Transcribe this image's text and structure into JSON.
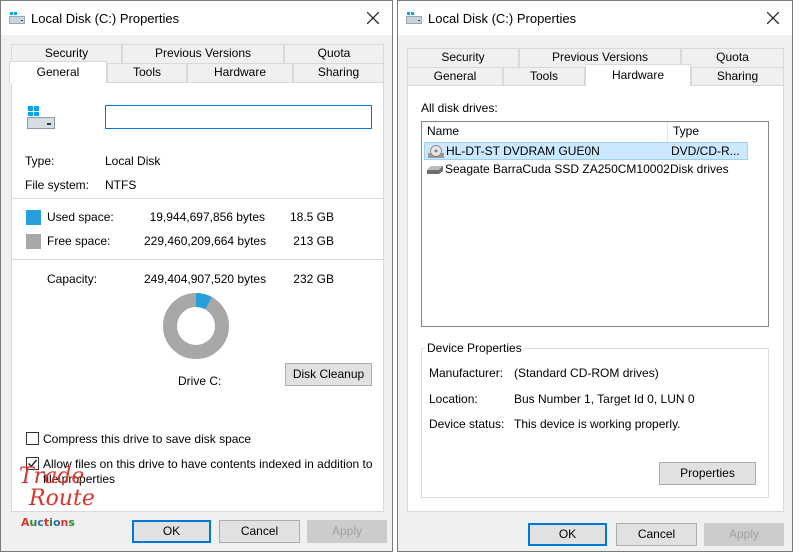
{
  "colors": {
    "used": "#26a0da",
    "free": "#a7a7a7",
    "selected_row": "#cce8ff"
  },
  "general_window": {
    "title": "Local Disk (C:) Properties",
    "tabs_top": [
      "Security",
      "Previous Versions",
      "Quota"
    ],
    "tabs_bottom": [
      "General",
      "Tools",
      "Hardware",
      "Sharing"
    ],
    "active_tab": "General",
    "name_value": "",
    "type_label": "Type:",
    "type_value": "Local Disk",
    "fs_label": "File system:",
    "fs_value": "NTFS",
    "used_label": "Used space:",
    "used_bytes": "19,944,697,856 bytes",
    "used_size": "18.5 GB",
    "free_label": "Free space:",
    "free_bytes": "229,460,209,664 bytes",
    "free_size": "213 GB",
    "capacity_label": "Capacity:",
    "capacity_bytes": "249,404,907,520 bytes",
    "capacity_size": "232 GB",
    "used_fraction": 0.08,
    "drive_label": "Drive C:",
    "disk_cleanup_button": "Disk Cleanup",
    "compress_label": "Compress this drive to save disk space",
    "compress_checked": false,
    "index_label_line1": "Allow files on this drive to have contents indexed in addition to",
    "index_label_line2": "file properties",
    "index_checked": true,
    "ok_button": "OK",
    "cancel_button": "Cancel",
    "apply_button": "Apply"
  },
  "hardware_window": {
    "title": "Local Disk (C:) Properties",
    "tabs_top": [
      "Security",
      "Previous Versions",
      "Quota"
    ],
    "tabs_bottom": [
      "General",
      "Tools",
      "Hardware",
      "Sharing"
    ],
    "active_tab": "Hardware",
    "drives_label": "All disk drives:",
    "columns": [
      "Name",
      "Type"
    ],
    "drives": [
      {
        "name": "HL-DT-ST DVDRAM GUE0N",
        "type": "DVD/CD-R...",
        "icon": "dvd-drive-icon",
        "selected": true
      },
      {
        "name": "Seagate BarraCuda SSD ZA250CM10002",
        "type": "Disk drives",
        "icon": "disk-drive-icon",
        "selected": false
      }
    ],
    "device_properties_title": "Device Properties",
    "manufacturer_label": "Manufacturer:",
    "manufacturer_value": "(Standard CD-ROM drives)",
    "location_label": "Location:",
    "location_value": "Bus Number 1, Target Id 0, LUN 0",
    "status_label": "Device status:",
    "status_value": "This device is working properly.",
    "properties_button": "Properties",
    "ok_button": "OK",
    "cancel_button": "Cancel",
    "apply_button": "Apply"
  },
  "watermark": {
    "line1": "Trade",
    "line2": "Route",
    "line3": "Auctions"
  }
}
